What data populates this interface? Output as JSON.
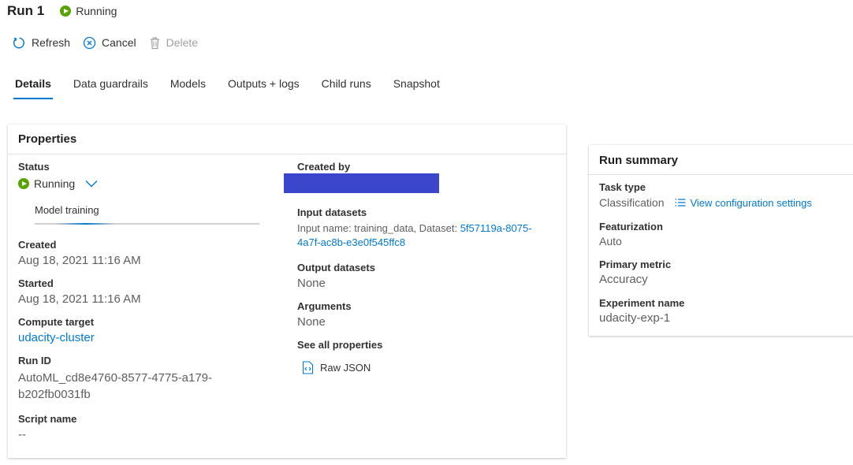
{
  "header": {
    "title": "Run 1",
    "status": "Running"
  },
  "toolbar": {
    "refresh": "Refresh",
    "cancel": "Cancel",
    "delete": "Delete"
  },
  "tabs": [
    {
      "label": "Details",
      "active": true
    },
    {
      "label": "Data guardrails"
    },
    {
      "label": "Models"
    },
    {
      "label": "Outputs + logs"
    },
    {
      "label": "Child runs"
    },
    {
      "label": "Snapshot"
    }
  ],
  "properties": {
    "title": "Properties",
    "status_label": "Status",
    "status_value": "Running",
    "progress_label": "Model training",
    "created_label": "Created",
    "created_value": "Aug 18, 2021 11:16 AM",
    "started_label": "Started",
    "started_value": "Aug 18, 2021 11:16 AM",
    "compute_label": "Compute target",
    "compute_value": "udacity-cluster",
    "runid_label": "Run ID",
    "runid_line1": "AutoML_cd8e4760-8577-4775-a179-",
    "runid_line2": "b202fb0031fb",
    "script_label": "Script name",
    "script_value": "--",
    "created_by_label": "Created by",
    "input_label": "Input datasets",
    "input_prefix": "Input name: training_data, Dataset: ",
    "input_link_line1": "5f57119a-8075-",
    "input_link_line2": "4a7f-ac8b-e3e0f545ffc8",
    "output_label": "Output datasets",
    "output_value": "None",
    "arguments_label": "Arguments",
    "arguments_value": "None",
    "see_all_label": "See all properties",
    "raw_json": "Raw JSON"
  },
  "summary": {
    "title": "Run summary",
    "task_type_label": "Task type",
    "task_type_value": "Classification",
    "view_config": "View configuration settings",
    "featurization_label": "Featurization",
    "featurization_value": "Auto",
    "primary_metric_label": "Primary metric",
    "primary_metric_value": "Accuracy",
    "experiment_label": "Experiment name",
    "experiment_value": "udacity-exp-1"
  },
  "colors": {
    "accent": "#0078d4",
    "running": "#57a300",
    "redaction": "#3b46cc"
  }
}
